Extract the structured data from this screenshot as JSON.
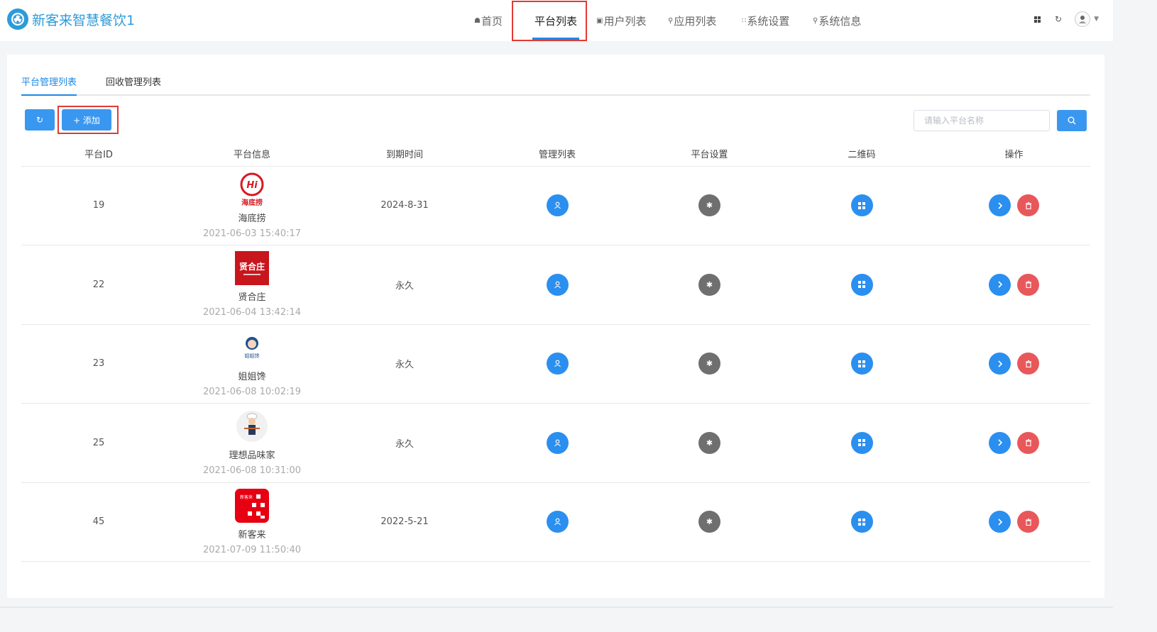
{
  "app": {
    "title": "新客来智慧餐饮1"
  },
  "nav": [
    {
      "label": "首页",
      "icon": "home-icon"
    },
    {
      "label": "平台列表",
      "icon": ""
    },
    {
      "label": "用户列表",
      "icon": "image-icon"
    },
    {
      "label": "应用列表",
      "icon": "search-icon"
    },
    {
      "label": "系统设置",
      "icon": "grid-icon"
    },
    {
      "label": "系统信息",
      "icon": "search-icon"
    }
  ],
  "tabs": [
    {
      "label": "平台管理列表",
      "active": true
    },
    {
      "label": "回收管理列表",
      "active": false
    }
  ],
  "toolbar": {
    "add_label": "+ 添加",
    "search_placeholder": "请输入平台名称"
  },
  "table": {
    "headers": [
      "平台ID",
      "平台信息",
      "到期时间",
      "管理列表",
      "平台设置",
      "二维码",
      "操作"
    ],
    "rows": [
      {
        "id": "19",
        "name": "海底捞",
        "date": "2021-06-03 15:40:17",
        "expire": "2024-8-31",
        "logo_text": "海底捞"
      },
      {
        "id": "22",
        "name": "贤合庄",
        "date": "2021-06-04 13:42:14",
        "expire": "永久",
        "logo_text": "贤合庄"
      },
      {
        "id": "23",
        "name": "姐姐馋",
        "date": "2021-06-08 10:02:19",
        "expire": "永久",
        "logo_text": "姐姐馋"
      },
      {
        "id": "25",
        "name": "理想品味家",
        "date": "2021-06-08 10:31:00",
        "expire": "永久",
        "logo_text": ""
      },
      {
        "id": "45",
        "name": "新客来",
        "date": "2021-07-09 11:50:40",
        "expire": "2022-5-21",
        "logo_text": "新客来"
      }
    ]
  },
  "colors": {
    "primary": "#2b8ff0",
    "danger": "#e8585b",
    "settings": "#6f6f6f",
    "brand": "#2d9bd9"
  }
}
